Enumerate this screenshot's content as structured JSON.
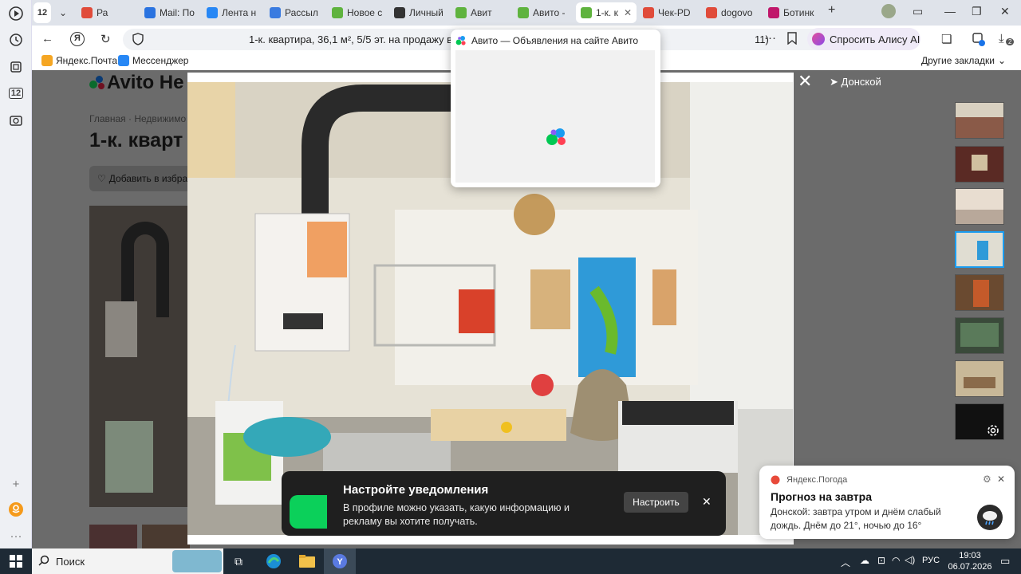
{
  "browser": {
    "tab_count": "12",
    "tabs": [
      {
        "title": "Ра",
        "color": "#e04b3a",
        "icon": "mail-icon"
      },
      {
        "title": "Mail: По",
        "color": "#2a73e0",
        "icon": "at-icon"
      },
      {
        "title": "Лента н",
        "color": "#2787f5",
        "icon": "vk-icon"
      },
      {
        "title": "Рассыл",
        "color": "#3a7be0",
        "icon": "envelope-icon"
      },
      {
        "title": "Новое с",
        "color": "#5fb33e",
        "icon": "avito-icon"
      },
      {
        "title": "Личный",
        "color": "#333333",
        "icon": "tiktok-icon"
      },
      {
        "title": "Авит",
        "color": "#5fb33e",
        "icon": "avito-icon"
      },
      {
        "title": "Авито -",
        "color": "#5fb33e",
        "icon": "avito-icon"
      },
      {
        "title": "1-к. к",
        "color": "#5fb33e",
        "icon": "avito-icon"
      },
      {
        "title": "Чек-PD",
        "color": "#e04b3a",
        "icon": "pdf-icon"
      },
      {
        "title": "dogovo",
        "color": "#e04b3a",
        "icon": "pdf-icon"
      },
      {
        "title": "Ботинк",
        "color": "#c0166a",
        "icon": "shop-icon"
      }
    ],
    "address": "1-к. квартира, 36,1 м², 5/5 эт. на продажу в Д",
    "address_tail": "11)",
    "alice_label": "Спросить Алису AI",
    "download_badge": "2",
    "bookmarks": [
      "Яндекс.Почта",
      "Мессенджер"
    ],
    "other_bookmarks": "Другие закладки",
    "left_panel_badge": "12"
  },
  "page": {
    "logo": "Avito Не",
    "breadcrumb": "Главная · Недвижимо",
    "title": "1-к. кварт",
    "favorite": "Добавить в избран",
    "location": "Донской"
  },
  "popup": {
    "title": "Авито — Объявления на сайте Авито"
  },
  "notification": {
    "title": "Настройте уведомления",
    "body": "В профиле можно указать, какую информацию и рекламу вы хотите получать.",
    "button": "Настроить"
  },
  "weather": {
    "source": "Яндекс.Погода",
    "title": "Прогноз на завтра",
    "body": "Донской: завтра утром и днём слабый дождь. Днём до 21°, ночью до 16°"
  },
  "taskbar": {
    "search_label": "Поиск",
    "lang": "РУС",
    "time": "19:03",
    "date": "06.07.2026"
  },
  "colors": {
    "notif_green": "#0bd05a",
    "thumb_selected": "#1a9cf0"
  }
}
